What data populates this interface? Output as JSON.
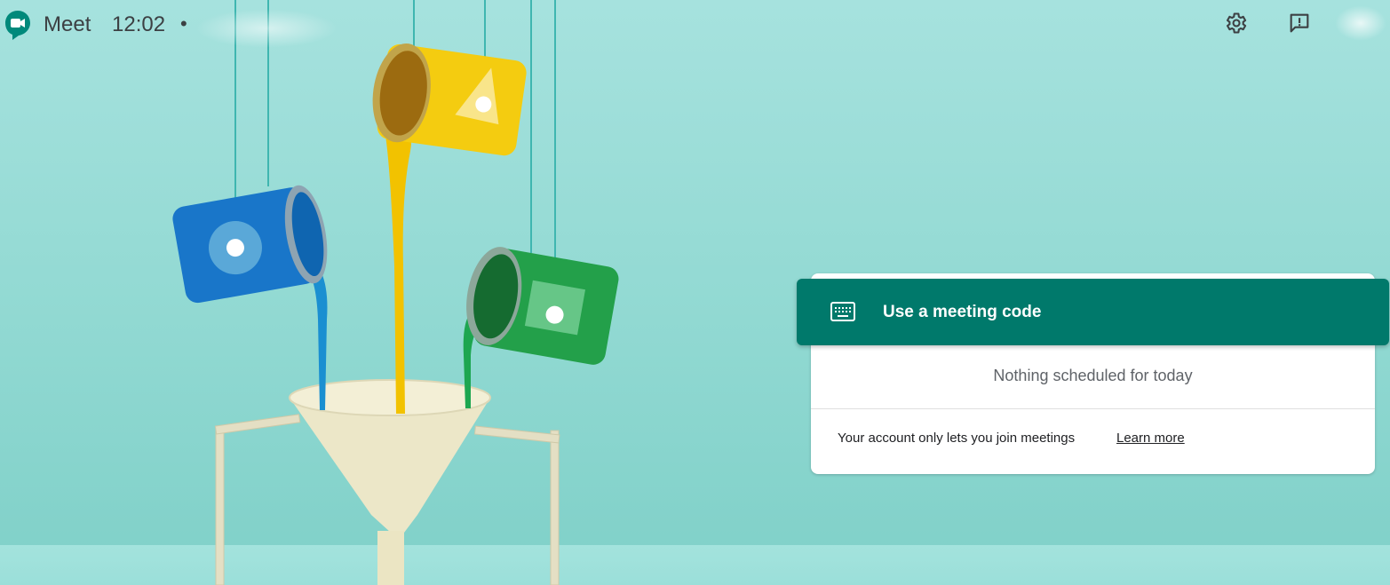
{
  "header": {
    "app_name": "Meet",
    "time": "12:02",
    "separator": "•"
  },
  "icons": {
    "logo": "google-meet-logo-icon",
    "settings": "gear-icon",
    "feedback": "feedback-icon",
    "keyboard": "keyboard-icon"
  },
  "card": {
    "meeting_code_label": "Use a meeting code",
    "empty_message": "Nothing scheduled for today",
    "account_message": "Your account only lets you join meetings",
    "learn_more_label": "Learn more"
  },
  "colors": {
    "accent": "#00796b",
    "background": "#9edcd6",
    "text": "#3c4043"
  }
}
